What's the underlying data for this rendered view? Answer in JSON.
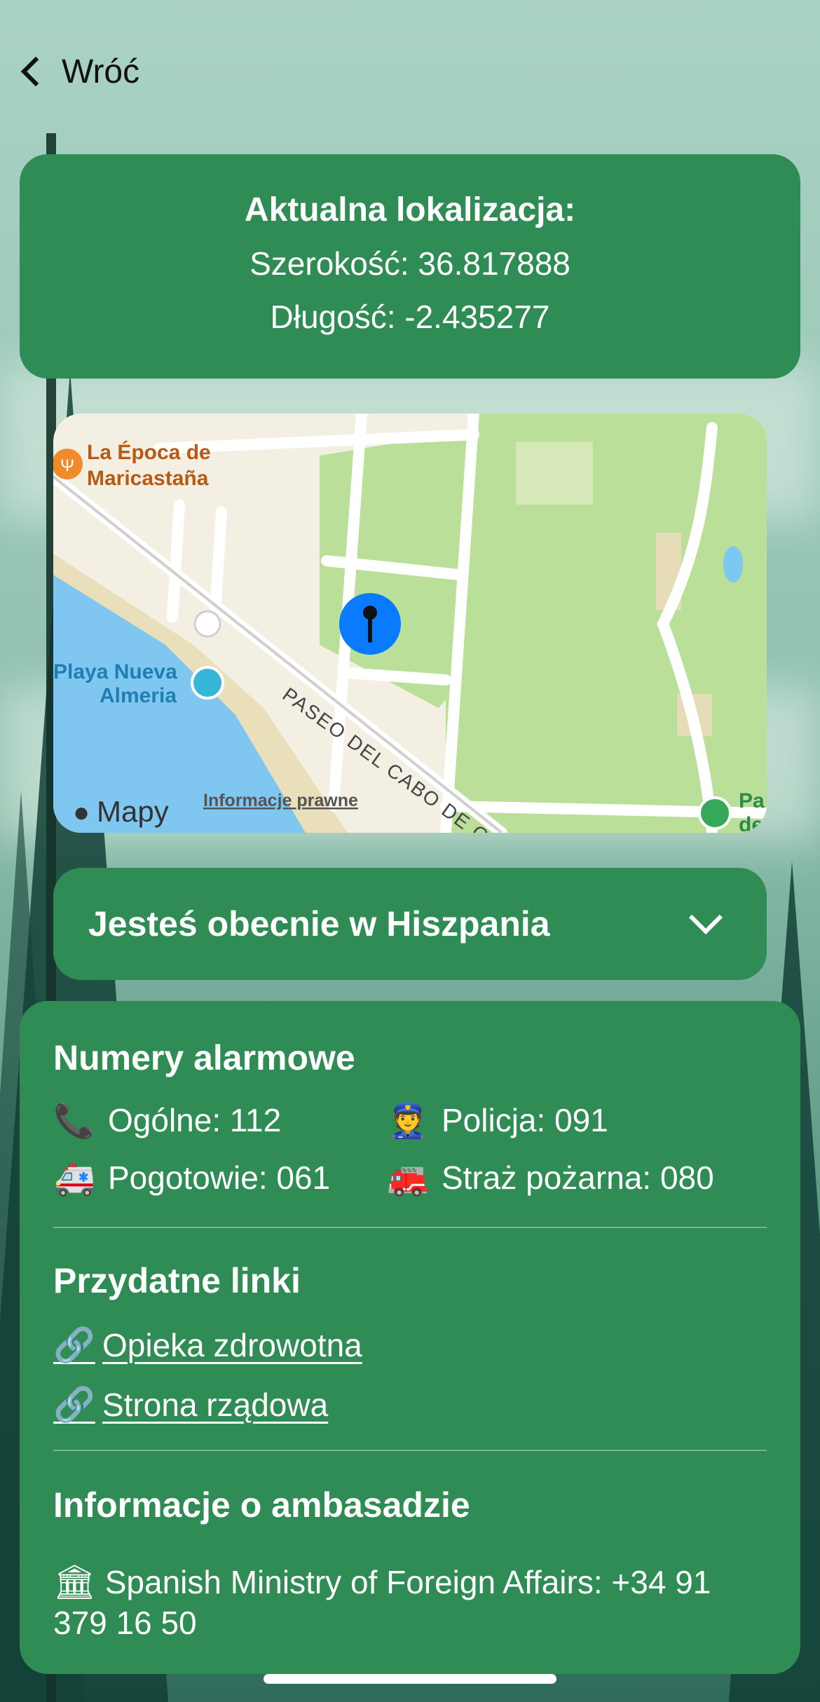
{
  "nav": {
    "back_label": "Wróć"
  },
  "location": {
    "title": "Aktualna lokalizacja:",
    "latitude_line": "Szerokość: 36.817888",
    "longitude_line": "Długość: -2.435277"
  },
  "map": {
    "poi_restaurant": [
      "La Época de",
      "Maricastaña"
    ],
    "poi_beach": [
      "Playa Nueva",
      "Almeria"
    ],
    "street": "PASEO DEL CABO DE GATA",
    "poi_park_partial": [
      "Pa",
      "de"
    ],
    "brand": "Mapy",
    "legal_link": "Informacje prawne"
  },
  "country": {
    "label": "Jesteś obecnie w Hiszpania"
  },
  "emergency": {
    "heading": "Numery alarmowe",
    "items": [
      {
        "icon": "telephone-icon",
        "label": "Ogólne: 112"
      },
      {
        "icon": "police-officer-icon",
        "label": "Policja: 091"
      },
      {
        "icon": "ambulance-icon",
        "label": "Pogotowie: 061"
      },
      {
        "icon": "fire-engine-icon",
        "label": "Straż pożarna: 080"
      }
    ]
  },
  "links": {
    "heading": "Przydatne linki",
    "items": [
      {
        "icon": "link-icon",
        "label": "Opieka zdrowotna"
      },
      {
        "icon": "link-icon",
        "label": "Strona rządowa"
      }
    ]
  },
  "embassy": {
    "heading": "Informacje o ambasadzie",
    "icon": "classical-building-icon",
    "text": "Spanish Ministry of Foreign Affairs: +34 91 379 16 50"
  },
  "colors": {
    "card": "#2f8c55",
    "pin": "#0a7aff"
  }
}
